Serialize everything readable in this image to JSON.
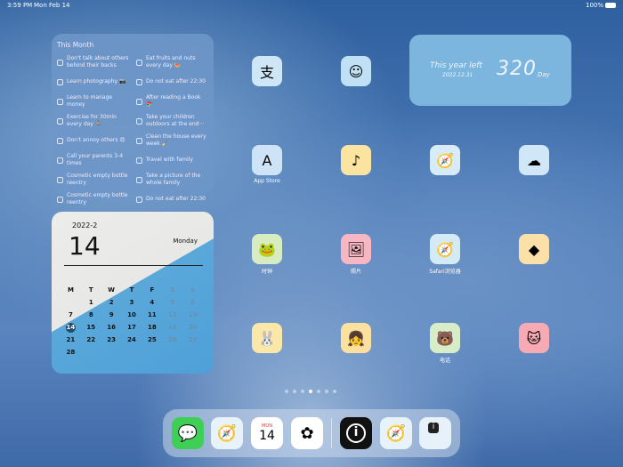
{
  "status": {
    "time": "3:59 PM",
    "date": "Mon Feb 14",
    "battery": "100%"
  },
  "todo": {
    "title": "This Month",
    "left": [
      "Don't talk about others behind their backs",
      "Learn photography 📷",
      "Learn to manage money",
      "Exercise for 30min every day 🏃",
      "Don't annoy others 😠",
      "Call your parents 3-4 times",
      "Cosmetic empty bottle reentry",
      "Cosmetic empty bottle reentry"
    ],
    "right": [
      "Eat fruits and nuts every day 🍉",
      "Do not eat after 22:30",
      "After reading a Book 📚",
      "Take your children outdoors at the end···",
      "Clean the house every week 🧹",
      "Travel with family",
      "Take a picture of the whole family",
      "Do not eat after 22:30"
    ]
  },
  "calendar": {
    "year_month": "2022-2",
    "day": "14",
    "weekday": "Monday",
    "headers": [
      "M",
      "T",
      "W",
      "T",
      "F",
      "S",
      "S"
    ],
    "days": [
      "",
      "1",
      "2",
      "3",
      "4",
      "5",
      "6",
      "7",
      "8",
      "9",
      "10",
      "11",
      "12",
      "13",
      "14",
      "15",
      "16",
      "17",
      "18",
      "19",
      "20",
      "21",
      "22",
      "23",
      "24",
      "25",
      "26",
      "27",
      "28"
    ],
    "today": "14"
  },
  "year_left": {
    "title": "This year left",
    "date": "2022.12.31",
    "count": "320",
    "unit": "Day"
  },
  "apps": [
    {
      "label": "",
      "icon": "支",
      "color": "#cfe6f7"
    },
    {
      "label": "",
      "icon": "☺",
      "color": "#bfe0f5"
    },
    {
      "label": "App Store",
      "icon": "A",
      "color": "#cfe3f6"
    },
    {
      "label": "",
      "icon": "♪",
      "color": "#fbe3a0"
    },
    {
      "label": "",
      "icon": "🧭",
      "color": "#d7ebf8"
    },
    {
      "label": "",
      "icon": "☁",
      "color": "#cfe7f7"
    },
    {
      "label": "时钟",
      "icon": "🐸",
      "color": "#d7ecc0"
    },
    {
      "label": "照片",
      "icon": "🖼",
      "color": "#f7b7c2"
    },
    {
      "label": "Safari浏览器",
      "icon": "🧭",
      "color": "#d4eaf7"
    },
    {
      "label": "",
      "icon": "◆",
      "color": "#fbe0a8"
    },
    {
      "label": "",
      "icon": "🐰",
      "color": "#fbe7a8"
    },
    {
      "label": "",
      "icon": "👧",
      "color": "#fbe0a0"
    },
    {
      "label": "电话",
      "icon": "🐻",
      "color": "#d6edc8"
    },
    {
      "label": "",
      "icon": "🐱",
      "color": "#f6aab4"
    }
  ],
  "dock": [
    {
      "name": "messages",
      "icon": "💬",
      "color": "#3fcf56"
    },
    {
      "name": "safari",
      "icon": "🧭",
      "color": "#e8f2fb"
    },
    {
      "name": "calendar",
      "icon": "14",
      "sub": "MON",
      "color": "#ffffff"
    },
    {
      "name": "photos",
      "icon": "✿",
      "color": "#ffffff"
    },
    {
      "name": "info",
      "icon": "i",
      "color": "#111111"
    },
    {
      "name": "safari-2",
      "icon": "🧭",
      "color": "#e8f2fb"
    },
    {
      "name": "widget-app",
      "icon": "i",
      "color": "#e6f1fa"
    }
  ],
  "pages": {
    "count": 7,
    "active": 4
  }
}
